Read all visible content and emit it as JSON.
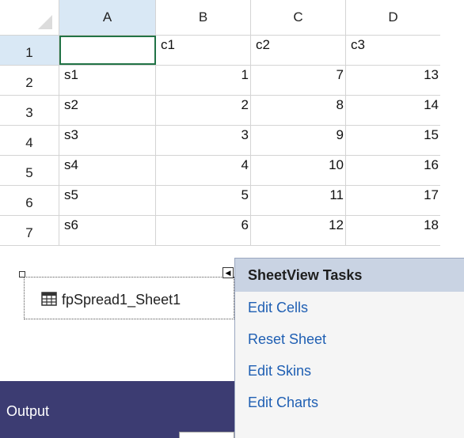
{
  "spreadsheet": {
    "columns": [
      "A",
      "B",
      "C",
      "D"
    ],
    "rows": [
      {
        "header": "1",
        "cells": [
          "",
          "c1",
          "c2",
          "c3"
        ]
      },
      {
        "header": "2",
        "cells": [
          "s1",
          "1",
          "7",
          "13"
        ]
      },
      {
        "header": "3",
        "cells": [
          "s2",
          "2",
          "8",
          "14"
        ]
      },
      {
        "header": "4",
        "cells": [
          "s3",
          "3",
          "9",
          "15"
        ]
      },
      {
        "header": "5",
        "cells": [
          "s4",
          "4",
          "10",
          "16"
        ]
      },
      {
        "header": "6",
        "cells": [
          "s5",
          "5",
          "11",
          "17"
        ]
      },
      {
        "header": "7",
        "cells": [
          "s6",
          "6",
          "12",
          "18"
        ]
      }
    ]
  },
  "component": {
    "label": "fpSpread1_Sheet1",
    "icon": "grid-table-icon"
  },
  "output": {
    "title": "Output"
  },
  "tasks_panel": {
    "title": "SheetView Tasks",
    "items": [
      "Edit Cells",
      "Reset Sheet",
      "Edit Skins",
      "Edit Charts"
    ]
  },
  "colors": {
    "selected_header": "#d9e8f5",
    "active_cell_border": "#217346",
    "output_bar": "#3c3c72",
    "task_link": "#1f5fb3",
    "tasks_header_bg": "#c9d3e3"
  }
}
